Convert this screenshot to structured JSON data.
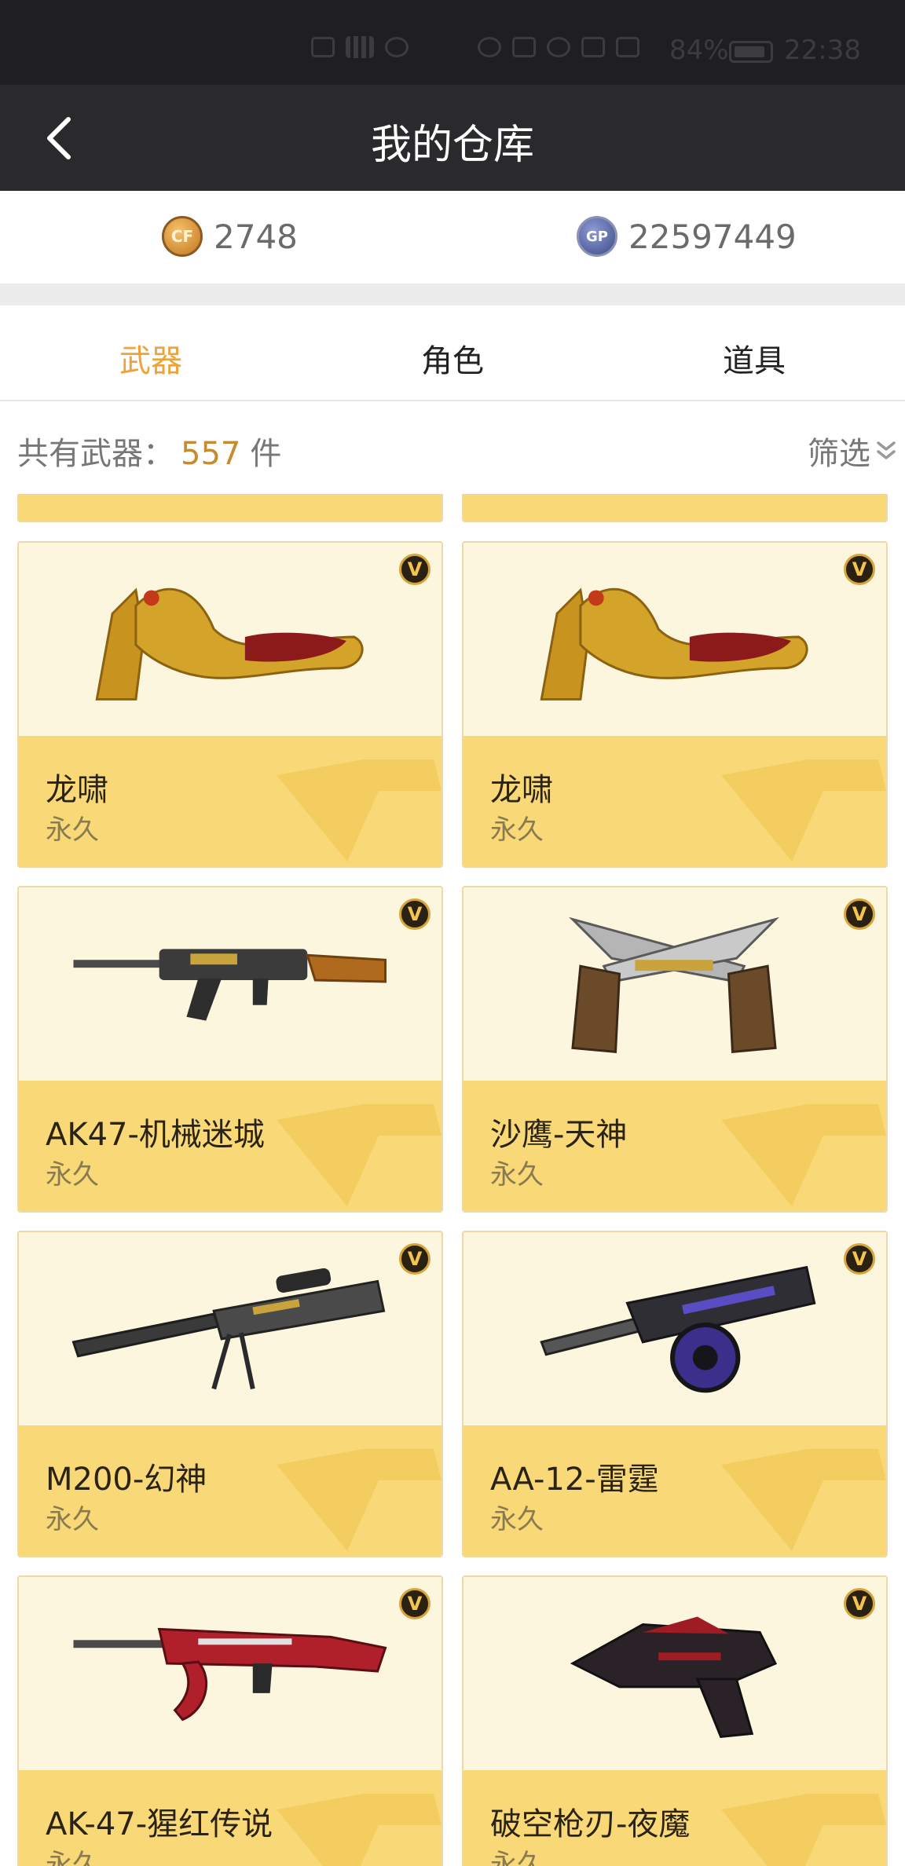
{
  "status_bar": {
    "battery": "84%",
    "time": "22:38"
  },
  "header": {
    "title": "我的仓库"
  },
  "currency": {
    "cf_points": "2748",
    "gp": "22597449"
  },
  "tabs": [
    {
      "label": "武器",
      "active": true
    },
    {
      "label": "角色",
      "active": false
    },
    {
      "label": "道具",
      "active": false
    }
  ],
  "inventory": {
    "count_label": "共有武器：",
    "count": "557",
    "unit": "件",
    "filter_label": "筛选"
  },
  "items": [
    {
      "name": "龙啸",
      "duration": "永久",
      "icon": "golden-dragon-axe-icon"
    },
    {
      "name": "龙啸",
      "duration": "永久",
      "icon": "golden-dragon-axe-icon"
    },
    {
      "name": "AK47-机械迷城",
      "duration": "永久",
      "icon": "assault-rifle-icon"
    },
    {
      "name": "沙鹰-天神",
      "duration": "永久",
      "icon": "dual-pistols-icon"
    },
    {
      "name": "M200-幻神",
      "duration": "永久",
      "icon": "sniper-rifle-icon"
    },
    {
      "name": "AA-12-雷霆",
      "duration": "永久",
      "icon": "drum-shotgun-icon"
    },
    {
      "name": "AK-47-猩红传说",
      "duration": "永久",
      "icon": "red-assault-rifle-icon"
    },
    {
      "name": "破空枪刃-夜魔",
      "duration": "永久",
      "icon": "blade-pistol-icon"
    }
  ],
  "colors": {
    "accent": "#eea23a",
    "card_top": "#fdf6df",
    "card_bottom": "#f9d977",
    "header_bg": "#2a2a2d"
  }
}
